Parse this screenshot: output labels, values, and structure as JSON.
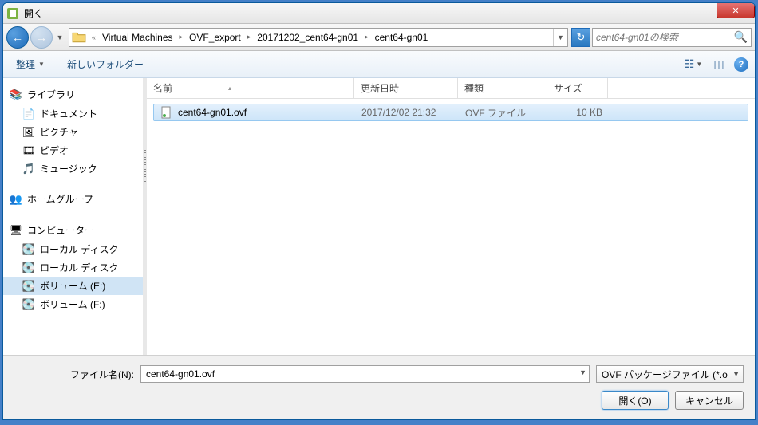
{
  "window": {
    "title": "開く"
  },
  "breadcrumb": {
    "segments": [
      "Virtual Machines",
      "OVF_export",
      "20171202_cent64-gn01",
      "cent64-gn01"
    ]
  },
  "search": {
    "placeholder": "cent64-gn01の検索"
  },
  "toolbar": {
    "organize": "整理",
    "newfolder": "新しいフォルダー"
  },
  "sidebar": {
    "library": {
      "label": "ライブラリ",
      "items": [
        "ドキュメント",
        "ピクチャ",
        "ビデオ",
        "ミュージック"
      ]
    },
    "homegroup": {
      "label": "ホームグループ"
    },
    "computer": {
      "label": "コンピューター",
      "items": [
        "ローカル ディスク",
        "ローカル ディスク",
        "ボリューム (E:)",
        "ボリューム (F:)"
      ]
    }
  },
  "columns": {
    "name": "名前",
    "date": "更新日時",
    "type": "種類",
    "size": "サイズ"
  },
  "files": [
    {
      "name": "cent64-gn01.ovf",
      "date": "2017/12/02 21:32",
      "type": "OVF ファイル",
      "size": "10 KB",
      "selected": true
    }
  ],
  "footer": {
    "filenamelabel": "ファイル名(N):",
    "filename": "cent64-gn01.ovf",
    "filetype": "OVF パッケージファイル (*.o",
    "open": "開く(O)",
    "cancel": "キャンセル"
  }
}
